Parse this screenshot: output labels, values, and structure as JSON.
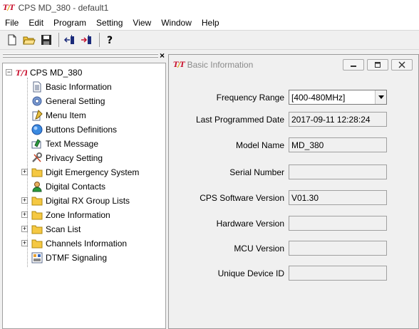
{
  "window": {
    "title": "CPS MD_380 - default1",
    "logo": "T/T"
  },
  "menu": [
    "File",
    "Edit",
    "Program",
    "Setting",
    "View",
    "Window",
    "Help"
  ],
  "toolbar": {
    "icons": [
      "new-file-icon",
      "open-folder-icon",
      "save-icon",
      "read-radio-icon",
      "write-radio-icon",
      "help-icon"
    ]
  },
  "tree": {
    "root": "CPS MD_380",
    "items": [
      {
        "label": "Basic Information",
        "icon": "document-icon",
        "expandable": false
      },
      {
        "label": "General Setting",
        "icon": "gear-icon",
        "expandable": false
      },
      {
        "label": "Menu Item",
        "icon": "menu-edit-icon",
        "expandable": false
      },
      {
        "label": "Buttons Definitions",
        "icon": "circle-button-icon",
        "expandable": false
      },
      {
        "label": "Text Message",
        "icon": "message-icon",
        "expandable": false
      },
      {
        "label": "Privacy Setting",
        "icon": "tools-icon",
        "expandable": false
      },
      {
        "label": "Digit Emergency System",
        "icon": "folder-icon",
        "expandable": true
      },
      {
        "label": "Digital Contacts",
        "icon": "contact-icon",
        "expandable": false
      },
      {
        "label": "Digital RX Group Lists",
        "icon": "folder-icon",
        "expandable": true
      },
      {
        "label": "Zone Information",
        "icon": "folder-icon",
        "expandable": true
      },
      {
        "label": "Scan List",
        "icon": "folder-icon",
        "expandable": true
      },
      {
        "label": "Channels Information",
        "icon": "folder-icon",
        "expandable": true
      },
      {
        "label": "DTMF Signaling",
        "icon": "dtmf-icon",
        "expandable": false
      }
    ]
  },
  "panel": {
    "title": "Basic Information",
    "fields": [
      {
        "label": "Frequency Range",
        "value": "[400-480MHz]",
        "type": "select"
      },
      {
        "label": "Last Programmed Date",
        "value": "2017-09-11 12:28:24",
        "type": "readonly"
      },
      {
        "label": "Model Name",
        "value": "MD_380",
        "type": "readonly"
      },
      {
        "label": "Serial Number",
        "value": "",
        "type": "readonly"
      },
      {
        "label": "CPS Software Version",
        "value": "V01.30",
        "type": "readonly"
      },
      {
        "label": "Hardware Version",
        "value": "",
        "type": "readonly"
      },
      {
        "label": "MCU Version",
        "value": "",
        "type": "readonly"
      },
      {
        "label": "Unique Device ID",
        "value": "",
        "type": "readonly"
      }
    ]
  },
  "colors": {
    "brand_red": "#c8102e",
    "brand_gold": "#e0a000",
    "folder_yellow": "#f5c842"
  }
}
